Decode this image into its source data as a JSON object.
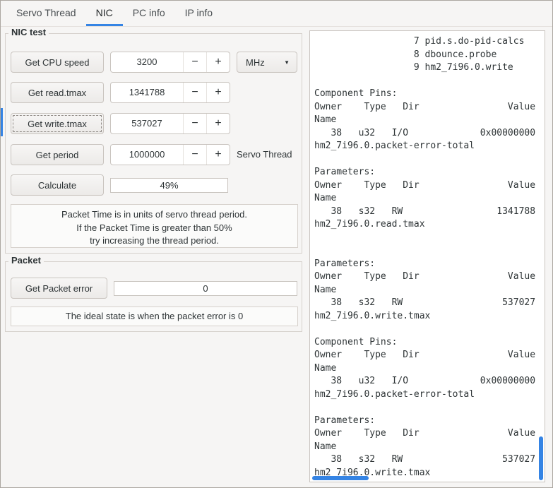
{
  "accent_color": "#3584e4",
  "tabs": [
    {
      "label": "Servo Thread"
    },
    {
      "label": "NIC"
    },
    {
      "label": "PC info"
    },
    {
      "label": "IP info"
    }
  ],
  "icons": {
    "minus": "−",
    "plus": "+",
    "dropdown_arrow": "▼"
  },
  "nic_test": {
    "legend": "NIC test",
    "rows": [
      {
        "button": "Get CPU speed",
        "value": "3200",
        "unit": "MHz"
      },
      {
        "button": "Get read.tmax",
        "value": "1341788"
      },
      {
        "button": "Get write.tmax",
        "value": "537027"
      },
      {
        "button": "Get period",
        "value": "1000000",
        "label": "Servo Thread"
      }
    ],
    "calculate_button": "Calculate",
    "progress_value": "49%",
    "info_lines": [
      "Packet Time is in units of servo thread period.",
      "If the Packet Time is greater than 50%",
      "try increasing the thread period."
    ]
  },
  "packet": {
    "legend": "Packet",
    "button": "Get Packet error",
    "value": "0",
    "info": "The ideal state is when the packet error is 0"
  },
  "output": {
    "lines": [
      "                  7 pid.s.do-pid-calcs",
      "                  8 dbounce.probe",
      "                  9 hm2_7i96.0.write",
      "",
      "Component Pins:",
      "Owner    Type   Dir                Value",
      "Name",
      "   38   u32   I/O             0x00000000",
      "hm2_7i96.0.packet-error-total",
      "",
      "Parameters:",
      "Owner    Type   Dir                Value",
      "Name",
      "   38   s32   RW                 1341788",
      "hm2_7i96.0.read.tmax",
      "",
      "",
      "Parameters:",
      "Owner    Type   Dir                Value",
      "Name",
      "   38   s32   RW                  537027",
      "hm2_7i96.0.write.tmax",
      "",
      "Component Pins:",
      "Owner    Type   Dir                Value",
      "Name",
      "   38   u32   I/O             0x00000000",
      "hm2_7i96.0.packet-error-total",
      "",
      "Parameters:",
      "Owner    Type   Dir                Value",
      "Name",
      "   38   s32   RW                  537027",
      "hm2_7i96.0.write.tmax"
    ]
  }
}
